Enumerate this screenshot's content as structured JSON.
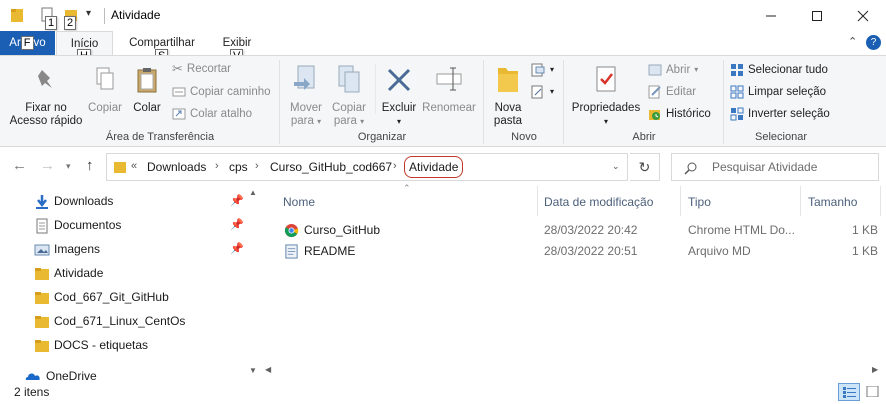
{
  "window": {
    "title": "Atividade",
    "keytips": [
      "1",
      "2"
    ]
  },
  "ribbon_tabs": {
    "file": {
      "label_pre": "Ar",
      "key": "F",
      "label_post": "vo"
    },
    "inicio": {
      "label": "Início",
      "key": "H"
    },
    "compartilhar": {
      "label": "Compartilhar",
      "key": "S"
    },
    "exibir": {
      "label": "Exibir",
      "key": "V"
    }
  },
  "ribbon": {
    "area_transferencia": {
      "label": "Área de Transferência",
      "fixar": "Fixar no\nAcesso rápido",
      "fixar_l1": "Fixar no",
      "fixar_l2": "Acesso rápido",
      "copiar": "Copiar",
      "colar": "Colar",
      "recortar": "Recortar",
      "copiar_caminho": "Copiar caminho",
      "colar_atalho": "Colar atalho"
    },
    "organizar": {
      "label": "Organizar",
      "mover_l1": "Mover",
      "mover_l2": "para",
      "copiar_l1": "Copiar",
      "copiar_l2": "para",
      "excluir": "Excluir",
      "renomear": "Renomear"
    },
    "novo": {
      "label": "Novo",
      "nova_l1": "Nova",
      "nova_l2": "pasta"
    },
    "abrir": {
      "label": "Abrir",
      "propriedades": "Propriedades",
      "abrir": "Abrir",
      "editar": "Editar",
      "historico": "Histórico"
    },
    "selecionar": {
      "label": "Selecionar",
      "tudo": "Selecionar tudo",
      "limpar": "Limpar seleção",
      "inverter": "Inverter seleção"
    }
  },
  "address": {
    "overflow": "«",
    "crumbs": [
      "Downloads",
      "cps",
      "Curso_GitHub_cod667",
      "Atividade"
    ],
    "search_placeholder": "Pesquisar Atividade"
  },
  "nav_pane": {
    "items": [
      {
        "label": "Downloads",
        "icon": "download-arrow-icon",
        "pinned": true
      },
      {
        "label": "Documentos",
        "icon": "document-icon",
        "pinned": true
      },
      {
        "label": "Imagens",
        "icon": "pictures-icon",
        "pinned": true
      },
      {
        "label": "Atividade",
        "icon": "folder-icon",
        "pinned": false
      },
      {
        "label": "Cod_667_Git_GitHub",
        "icon": "folder-icon",
        "pinned": false
      },
      {
        "label": "Cod_671_Linux_CentOs",
        "icon": "folder-icon",
        "pinned": false
      },
      {
        "label": "DOCS - etiquetas",
        "icon": "folder-icon",
        "pinned": false
      },
      {
        "label": "OneDrive",
        "icon": "cloud-icon",
        "pinned": false
      }
    ]
  },
  "columns": {
    "name": "Nome",
    "date": "Data de modificação",
    "type": "Tipo",
    "size": "Tamanho"
  },
  "files": [
    {
      "name": "Curso_GitHub",
      "date": "28/03/2022 20:42",
      "type": "Chrome HTML Do...",
      "size": "1 KB",
      "icon": "chrome-icon"
    },
    {
      "name": "README",
      "date": "28/03/2022 20:51",
      "type": "Arquivo MD",
      "size": "1 KB",
      "icon": "text-file-icon"
    }
  ],
  "status": {
    "count": "2 itens"
  },
  "colors": {
    "file_tab": "#1a5fb4",
    "folder": "#e8b931",
    "highlight_outline": "#c0392b",
    "header_text": "#4c607a"
  }
}
